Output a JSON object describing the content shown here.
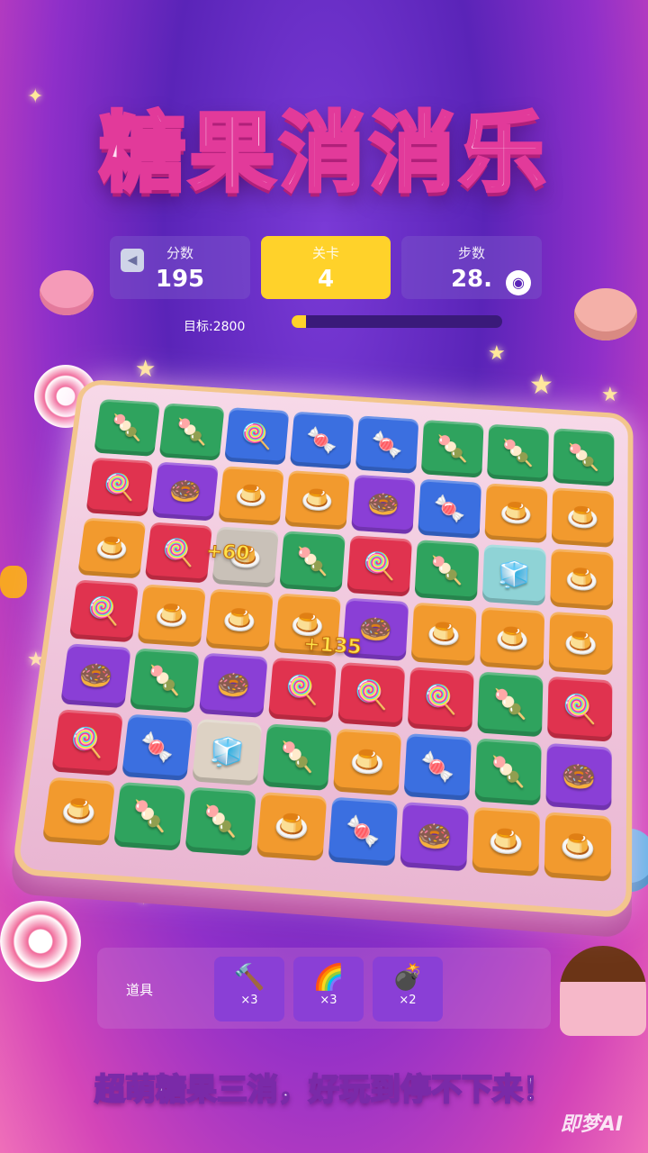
{
  "title": "糖果消消乐",
  "stats": {
    "score_label": "分数",
    "score_value": "195",
    "level_label": "关卡",
    "level_value": "4",
    "moves_label": "步数",
    "moves_value": "28."
  },
  "target": {
    "label": "目标:2800",
    "progress": 0.07
  },
  "icons": {
    "back": "back-arrow-icon",
    "target": "target-icon"
  },
  "board": {
    "rows": [
      [
        [
          "#2fa35e",
          "🍡"
        ],
        [
          "#2fa35e",
          "🍡"
        ],
        [
          "#3b6fe0",
          "🍭"
        ],
        [
          "#3b6fe0",
          "🍬"
        ],
        [
          "#3b6fe0",
          "🍬"
        ],
        [
          "#2fa35e",
          "🍡"
        ],
        [
          "#2fa35e",
          "🍡"
        ],
        [
          "#2fa35e",
          "🍡"
        ]
      ],
      [
        [
          "#e0334f",
          "🍭"
        ],
        [
          "#8a3fd6",
          "🍩"
        ],
        [
          "#f29a2e",
          "🍮"
        ],
        [
          "#f29a2e",
          "🍮"
        ],
        [
          "#8a3fd6",
          "🍩"
        ],
        [
          "#3b6fe0",
          "🍬"
        ],
        [
          "#f29a2e",
          "🍮"
        ],
        [
          "#f29a2e",
          "🍮"
        ]
      ],
      [
        [
          "#f29a2e",
          "🍮"
        ],
        [
          "#e0334f",
          "🍭"
        ],
        [
          "#c9c1b8",
          "🍮"
        ],
        [
          "#2fa35e",
          "🍡"
        ],
        [
          "#e0334f",
          "🍭"
        ],
        [
          "#2fa35e",
          "🍡"
        ],
        [
          "#8fd3d6",
          "🧊"
        ],
        [
          "#f29a2e",
          "🍮"
        ]
      ],
      [
        [
          "#e0334f",
          "🍭"
        ],
        [
          "#f29a2e",
          "🍮"
        ],
        [
          "#f29a2e",
          "🍮"
        ],
        [
          "#f29a2e",
          "🍮"
        ],
        [
          "#8a3fd6",
          "🍩"
        ],
        [
          "#f29a2e",
          "🍮"
        ],
        [
          "#f29a2e",
          "🍮"
        ],
        [
          "#f29a2e",
          "🍮"
        ]
      ],
      [
        [
          "#8a3fd6",
          "🍩"
        ],
        [
          "#2fa35e",
          "🍡"
        ],
        [
          "#8a3fd6",
          "🍩"
        ],
        [
          "#e0334f",
          "🍭"
        ],
        [
          "#e0334f",
          "🍭"
        ],
        [
          "#e0334f",
          "🍭"
        ],
        [
          "#2fa35e",
          "🍡"
        ],
        [
          "#e0334f",
          "🍭"
        ]
      ],
      [
        [
          "#e0334f",
          "🍭"
        ],
        [
          "#3b6fe0",
          "🍬"
        ],
        [
          "#ddd2c4",
          "🧊"
        ],
        [
          "#2fa35e",
          "🍡"
        ],
        [
          "#f29a2e",
          "🍮"
        ],
        [
          "#3b6fe0",
          "🍬"
        ],
        [
          "#2fa35e",
          "🍡"
        ],
        [
          "#8a3fd6",
          "🍩"
        ]
      ],
      [
        [
          "#f29a2e",
          "🍮"
        ],
        [
          "#2fa35e",
          "🍡"
        ],
        [
          "#2fa35e",
          "🍡"
        ],
        [
          "#f29a2e",
          "🍮"
        ],
        [
          "#3b6fe0",
          "🍬"
        ],
        [
          "#8a3fd6",
          "🍩"
        ],
        [
          "#f29a2e",
          "🍮"
        ],
        [
          "#f29a2e",
          "🍮"
        ]
      ]
    ]
  },
  "popups": [
    "+60",
    "+135"
  ],
  "tools": {
    "label": "道具",
    "items": [
      {
        "icon": "hammer-icon",
        "glyph": "🔨",
        "count": "×3"
      },
      {
        "icon": "rainbow-icon",
        "glyph": "🌈",
        "count": "×3"
      },
      {
        "icon": "bomb-icon",
        "glyph": "💣",
        "count": "×2"
      }
    ]
  },
  "slogan": "超萌糖果三消，好玩到停不下来！",
  "watermark": "即梦AI"
}
